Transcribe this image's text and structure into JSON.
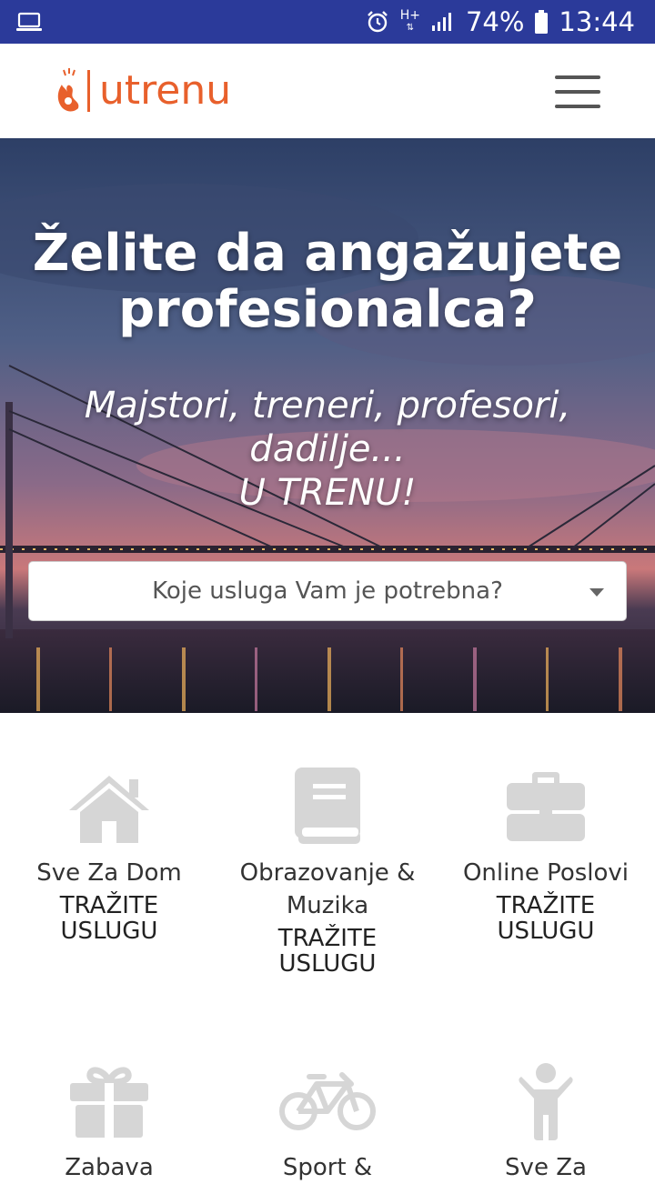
{
  "status_bar": {
    "battery": "74%",
    "time": "13:44",
    "network": "H+"
  },
  "header": {
    "logo_text": "utrenu",
    "menu_icon": "hamburger-icon"
  },
  "hero": {
    "title": "Želite da angažujete profesionalca?",
    "subtitle_lines": [
      "Majstori, treneri, profesori,",
      "dadilje...",
      "U TRENU!"
    ],
    "select_placeholder": "Koje usluga Vam je potrebna?"
  },
  "categories": [
    {
      "name": "Sve Za Dom",
      "cta": "TRAŽITE USLUGU",
      "icon": "house-icon"
    },
    {
      "name": "Obrazovanje & Muzika",
      "cta": "TRAŽITE USLUGU",
      "icon": "book-icon"
    },
    {
      "name": "Online Poslovi",
      "cta": "TRAŽITE USLUGU",
      "icon": "briefcase-icon"
    },
    {
      "name": "Zabava",
      "cta": "",
      "icon": "gift-icon"
    },
    {
      "name": "Sport &",
      "cta": "",
      "icon": "bicycle-icon"
    },
    {
      "name": "Sve Za",
      "cta": "",
      "icon": "person-icon"
    }
  ],
  "colors": {
    "status_bar": "#2b3a9a",
    "brand": "#e8602c",
    "icon_gray": "#d6d6d6"
  }
}
